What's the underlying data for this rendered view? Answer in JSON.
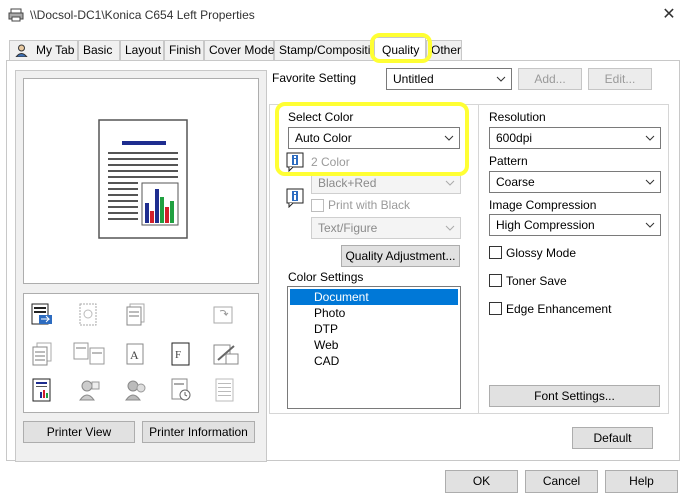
{
  "window": {
    "title": "\\\\Docsol-DC1\\Konica C654 Left Properties",
    "close_glyph": "✕"
  },
  "tabs": [
    {
      "label": "My Tab",
      "icon": "user-icon"
    },
    {
      "label": "Basic"
    },
    {
      "label": "Layout"
    },
    {
      "label": "Finish"
    },
    {
      "label": "Cover Mode"
    },
    {
      "label": "Stamp/Compositio"
    },
    {
      "label": "Quality",
      "active": true
    },
    {
      "label": "Other"
    }
  ],
  "left_panel": {
    "printer_view_label": "Printer View",
    "printer_information_label": "Printer Information"
  },
  "favorite": {
    "label": "Favorite Setting",
    "value": "Untitled",
    "add_label": "Add...",
    "edit_label": "Edit..."
  },
  "color": {
    "select_label": "Select Color",
    "select_value": "Auto Color",
    "two_color_label": "2 Color",
    "two_color_value": "Black+Red",
    "print_with_black_label": "Print with Black",
    "text_figure_value": "Text/Figure",
    "quality_adjustment_label": "Quality Adjustment..."
  },
  "color_settings": {
    "label": "Color Settings",
    "items": [
      "Document",
      "Photo",
      "DTP",
      "Web",
      "CAD"
    ],
    "selected": "Document"
  },
  "resolution": {
    "label": "Resolution",
    "value": "600dpi"
  },
  "pattern": {
    "label": "Pattern",
    "value": "Coarse"
  },
  "image_compression": {
    "label": "Image Compression",
    "value": "High Compression"
  },
  "options": {
    "glossy_mode": "Glossy Mode",
    "toner_save": "Toner Save",
    "edge_enhancement": "Edge Enhancement"
  },
  "font_settings_label": "Font Settings...",
  "default_label": "Default",
  "footer": {
    "ok": "OK",
    "cancel": "Cancel",
    "help": "Help"
  },
  "colors": {
    "highlight": "#ffff33",
    "selection": "#0078d7",
    "info_blue": "#2d6cc0"
  }
}
